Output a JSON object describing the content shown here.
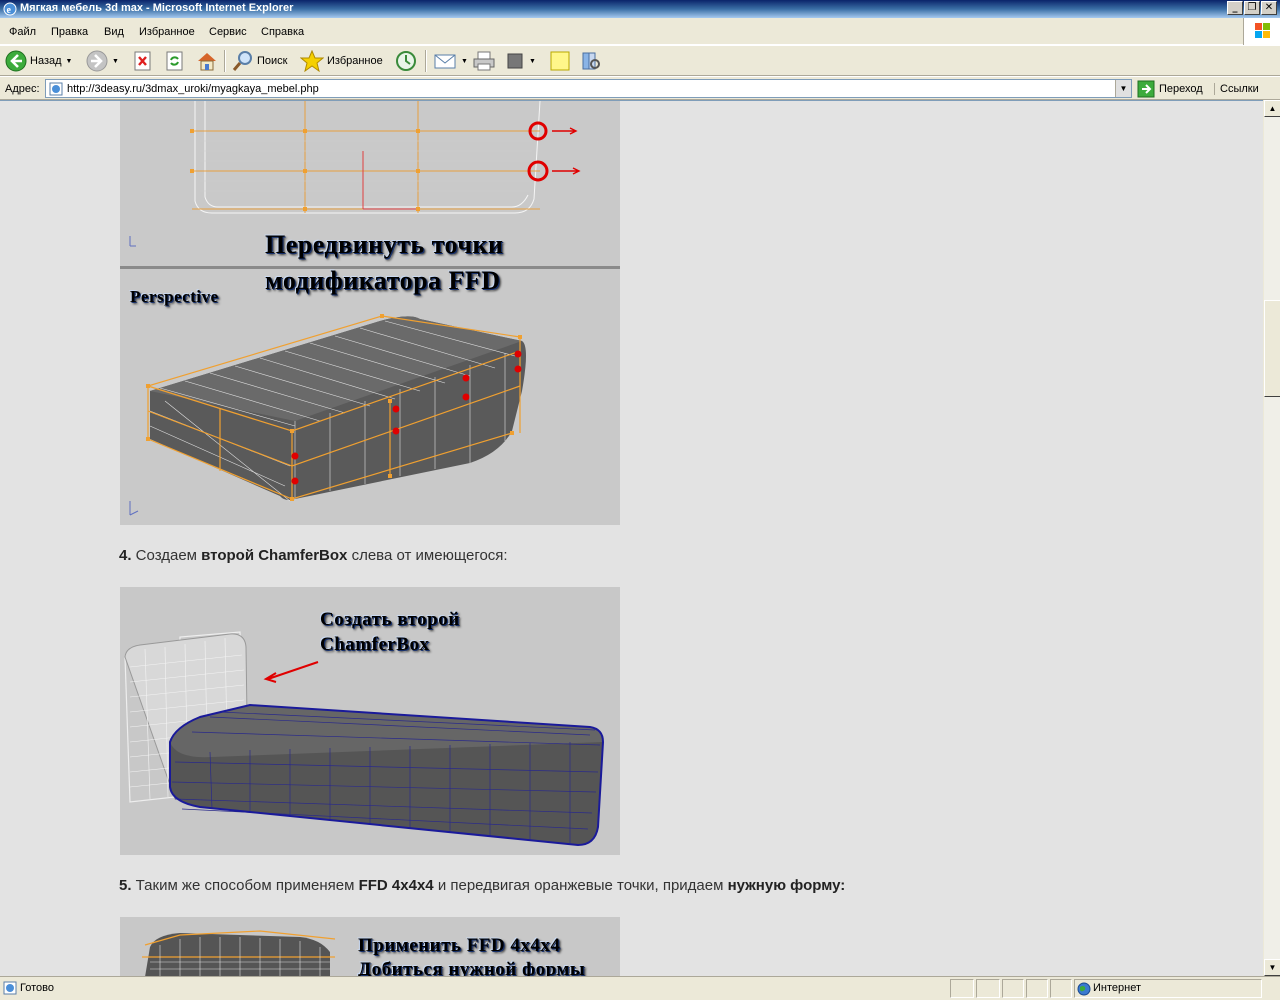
{
  "window": {
    "title": "Мягкая мебель 3d max - Microsoft Internet Explorer",
    "buttons": [
      "_",
      "❐",
      "✕"
    ]
  },
  "menu": {
    "items": [
      "Файл",
      "Правка",
      "Вид",
      "Избранное",
      "Сервис",
      "Справка"
    ]
  },
  "toolbar": {
    "back_label": "Назад",
    "search_label": "Поиск",
    "favorites_label": "Избранное"
  },
  "address": {
    "label": "Адрес:",
    "url": "http://3deasy.ru/3dmax_uroki/myagkaya_mebel.php",
    "go_label": "Переход",
    "links_label": "Ссылки"
  },
  "page": {
    "image1": {
      "caption_line1": "Передвинуть точки",
      "caption_line2": "модификатора FFD",
      "viewport_label": "Perspective"
    },
    "step4": {
      "number": "4.",
      "text_a": " Создаем ",
      "bold": "второй ChamferBox",
      "text_b": " слева от имеющегося:"
    },
    "image2": {
      "caption_line1": "Создать второй",
      "caption_line2": "ChamferBox"
    },
    "step5": {
      "number": "5.",
      "text_a": " Таким же способом применяем ",
      "bold1": "FFD 4x4x4",
      "text_b": " и передвигая оранжевые точки, придаем ",
      "bold2": "нужную форму:"
    },
    "image3": {
      "caption_line1": "Применить FFD 4x4x4",
      "caption_line2": "Добиться нужной формы"
    }
  },
  "status": {
    "text": "Готово",
    "zone": "Интернет"
  },
  "colors": {
    "titlebar": "#0a246a",
    "chrome": "#ece9d8",
    "content_bg": "#e3e3e3",
    "caption_blue": "#3f6fb5",
    "ffd_orange": "#f0a030",
    "ffd_red": "#e00000"
  }
}
